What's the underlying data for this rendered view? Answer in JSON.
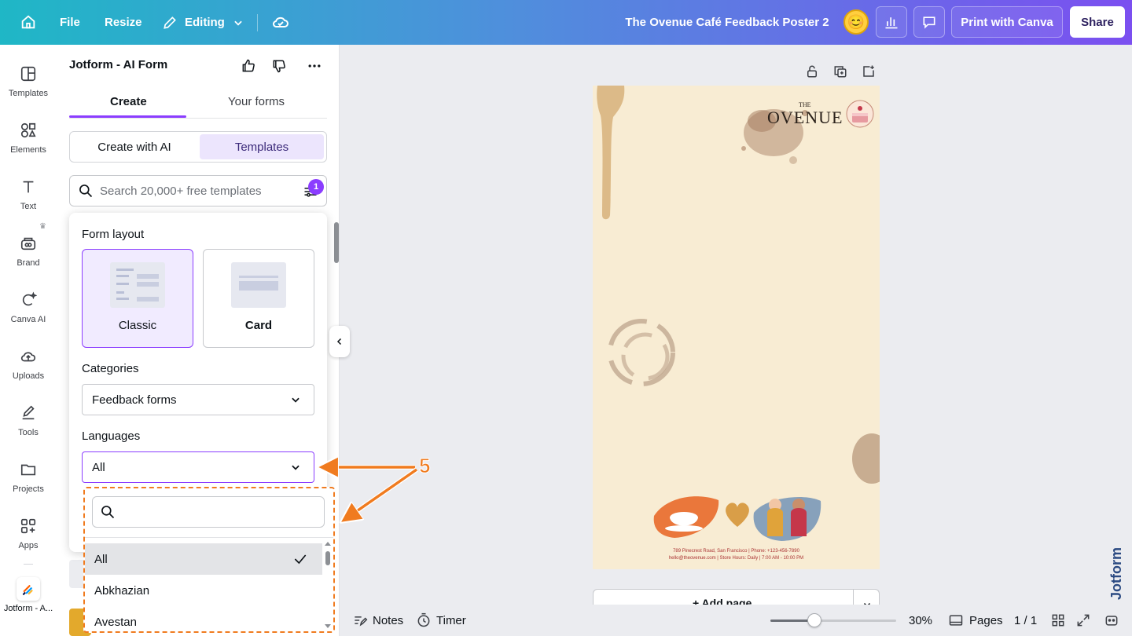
{
  "topbar": {
    "file_label": "File",
    "resize_label": "Resize",
    "editing_label": "Editing",
    "doc_title": "The Ovenue Café Feedback Poster 2",
    "print_label": "Print with Canva",
    "share_label": "Share"
  },
  "rail": {
    "items": [
      {
        "label": "Templates"
      },
      {
        "label": "Elements"
      },
      {
        "label": "Text"
      },
      {
        "label": "Brand"
      },
      {
        "label": "Canva AI"
      },
      {
        "label": "Uploads"
      },
      {
        "label": "Tools"
      },
      {
        "label": "Projects"
      },
      {
        "label": "Apps"
      },
      {
        "label": "Jotform - A..."
      }
    ]
  },
  "panel": {
    "title": "Jotform - AI Form",
    "tabs": [
      {
        "label": "Create"
      },
      {
        "label": "Your forms"
      }
    ],
    "segments": [
      {
        "label": "Create with AI"
      },
      {
        "label": "Templates"
      }
    ],
    "search_placeholder": "Search 20,000+ free templates",
    "filter_badge": "1"
  },
  "filters": {
    "layout_heading": "Form layout",
    "layouts": [
      {
        "label": "Classic"
      },
      {
        "label": "Card"
      }
    ],
    "categories_heading": "Categories",
    "category_value": "Feedback forms",
    "languages_heading": "Languages",
    "language_value": "All",
    "language_options": [
      {
        "label": "All"
      },
      {
        "label": "Abkhazian"
      },
      {
        "label": "Avestan"
      }
    ]
  },
  "annotation": {
    "step": "5"
  },
  "poster": {
    "logo_the": "THE",
    "logo_name": "OVENUE",
    "footer_line1": "789 Pinecrest Road, San Francisco | Phone: +123-456-7890",
    "footer_line2": "hello@theovenue.com | Store Hours: Daily | 7:00 AM - 10:00 PM"
  },
  "canvas": {
    "add_page_label": "+ Add page"
  },
  "bottombar": {
    "notes_label": "Notes",
    "timer_label": "Timer",
    "zoom_value": "30%",
    "pages_label": "Pages",
    "page_count": "1 / 1",
    "zoom_fraction": 0.3
  },
  "jotform_side": {
    "label": "Jotform"
  },
  "colors": {
    "accent": "#8b3dff",
    "annotation": "#f07b1f"
  }
}
